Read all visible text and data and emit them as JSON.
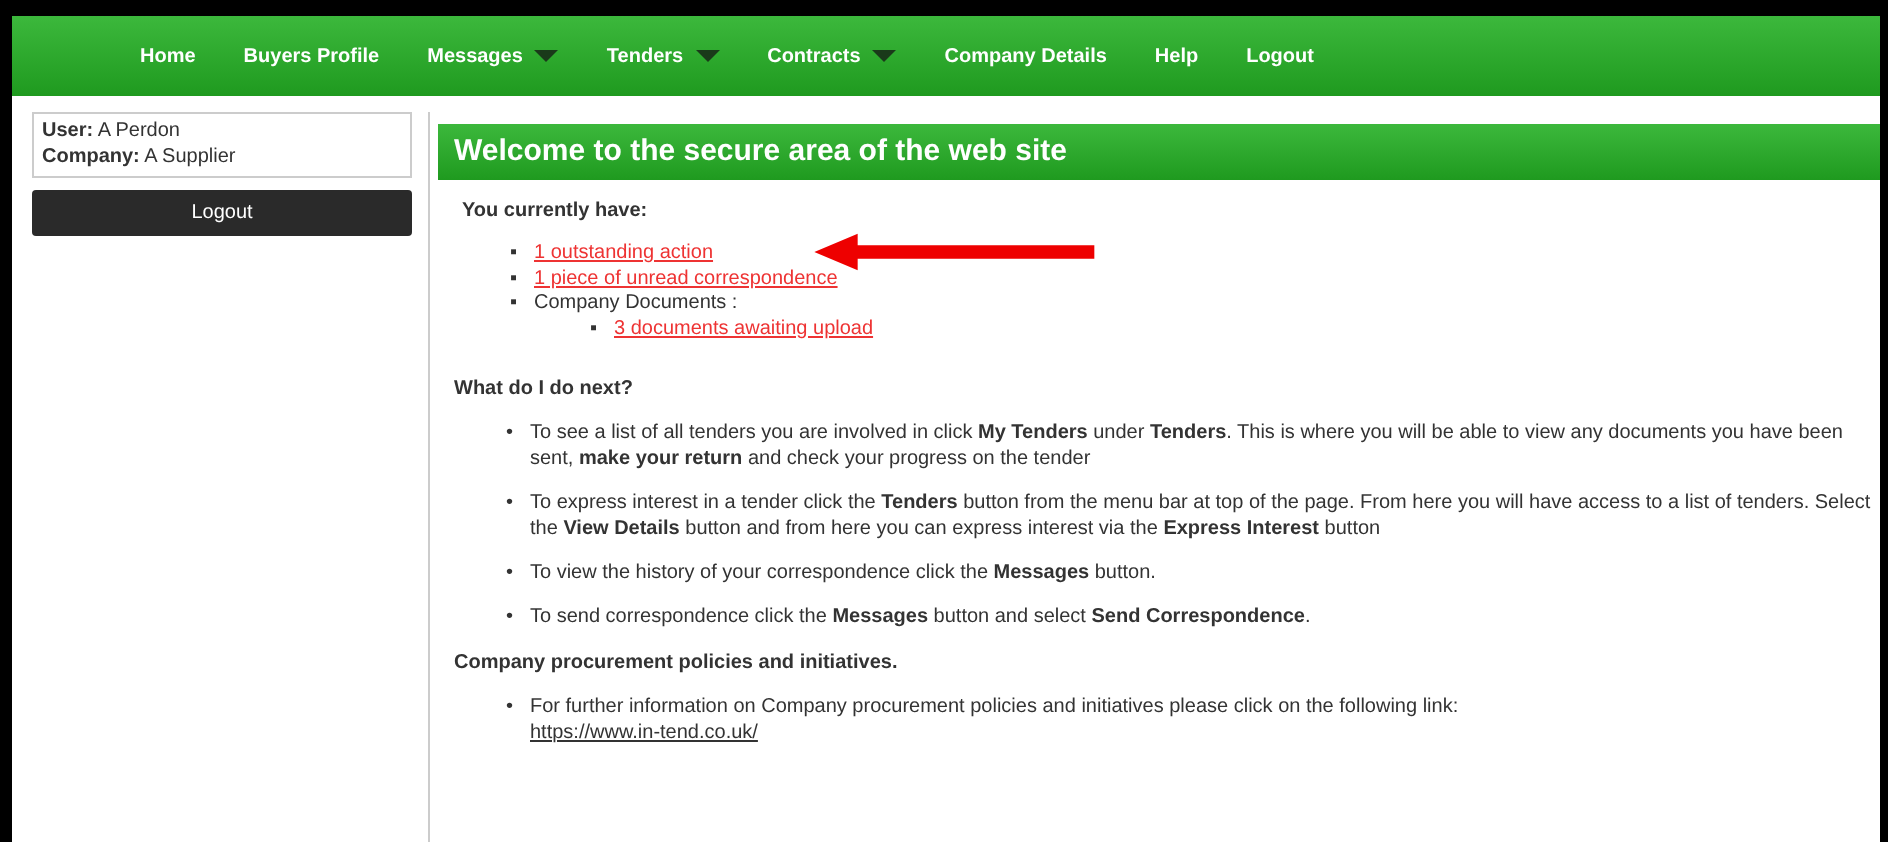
{
  "nav": [
    {
      "label": "Home",
      "dropdown": false
    },
    {
      "label": "Buyers Profile",
      "dropdown": false
    },
    {
      "label": "Messages",
      "dropdown": true
    },
    {
      "label": "Tenders",
      "dropdown": true
    },
    {
      "label": "Contracts",
      "dropdown": true
    },
    {
      "label": "Company Details",
      "dropdown": false
    },
    {
      "label": "Help",
      "dropdown": false
    },
    {
      "label": "Logout",
      "dropdown": false
    }
  ],
  "sidebar": {
    "user_label": "User:",
    "user": "A Perdon",
    "company_label": "Company:",
    "company": "A Supplier",
    "logout": "Logout"
  },
  "main": {
    "title": "Welcome to the secure area of the web site",
    "have_heading": "You currently have:",
    "have_items": [
      {
        "kind": "link",
        "marker": "▪",
        "text": "1 outstanding action"
      },
      {
        "kind": "link",
        "marker": "▪",
        "text": "1 piece of unread correspondence"
      },
      {
        "kind": "text",
        "marker": "▪",
        "text": "Company Documents :",
        "children": [
          {
            "kind": "link",
            "marker": "▪",
            "text": "3 documents awaiting upload"
          }
        ]
      }
    ],
    "bullet": "•",
    "next_heading": "What do I do next?",
    "next_items": [
      "To see a list of all tenders you are involved in click **My Tenders** under **Tenders**. This is where you will be able to view any documents you have been sent, **make your return** and check your progress on the tender",
      "To express interest in a tender click the **Tenders** button from the menu bar at top of the page. From here you will have access to a list of tenders. Select the **View Details** button and from here you can express interest via the **Express Interest** button",
      "To view the history of your correspondence click the **Messages** button.",
      "To send correspondence click the **Messages** button and select **Send Correspondence**."
    ],
    "policy_bullet": "•",
    "policy_heading": "Company procurement policies and initiatives.",
    "policy_text": "For further information on Company procurement policies and initiatives please click on the following link:",
    "policy_link": "https://www.in-tend.co.uk/"
  }
}
